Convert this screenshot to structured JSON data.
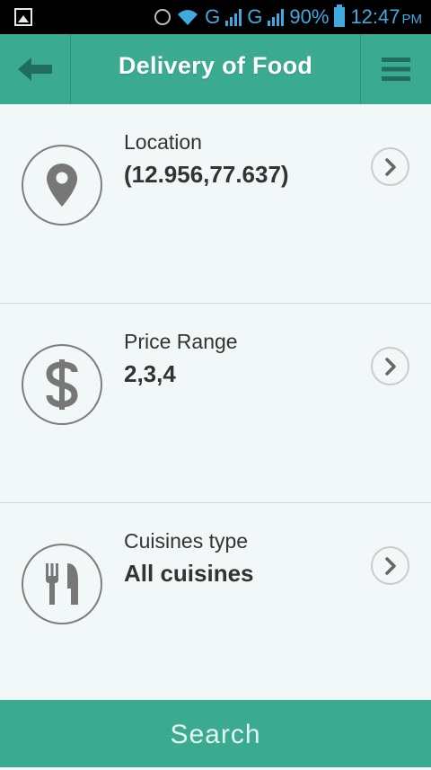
{
  "status_bar": {
    "network_1": "G",
    "network_2": "G",
    "battery": "90%",
    "time": "12:47",
    "ampm": "PM"
  },
  "header": {
    "title": "Delivery of Food"
  },
  "filters": [
    {
      "label": "Location",
      "value": "(12.956,77.637)"
    },
    {
      "label": "Price Range",
      "value": "2,3,4"
    },
    {
      "label": "Cuisines type",
      "value": "All cuisines"
    }
  ],
  "search": {
    "label": "Search"
  },
  "colors": {
    "accent": "#3aaa91",
    "icon": "#7d7d7d",
    "chevron": "#ccc",
    "background": "#f2f7f7"
  },
  "icons": [
    "back-arrow-icon",
    "menu-icon",
    "location-pin-icon",
    "dollar-icon",
    "cutlery-icon",
    "chevron-right-icon"
  ]
}
